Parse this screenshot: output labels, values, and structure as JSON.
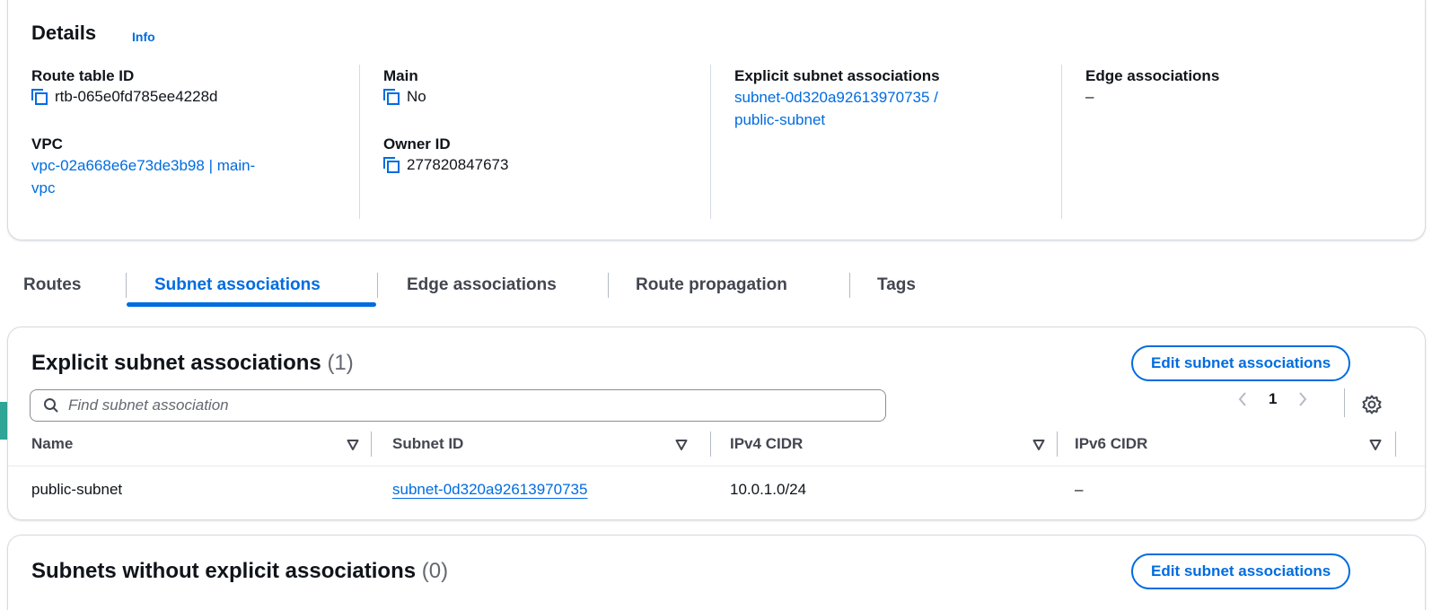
{
  "details": {
    "title": "Details",
    "info": "Info",
    "route_table_id_label": "Route table ID",
    "route_table_id": "rtb-065e0fd785ee4228d",
    "vpc_label": "VPC",
    "vpc_line1": "vpc-02a668e6e73de3b98 | main-",
    "vpc_line2": "vpc",
    "main_label": "Main",
    "main_value": "No",
    "owner_label": "Owner ID",
    "owner_value": "277820847673",
    "explicit_label": "Explicit subnet associations",
    "explicit_line1": "subnet-0d320a92613970735 /",
    "explicit_line2": "public-subnet",
    "edge_label": "Edge associations",
    "edge_value": "–"
  },
  "tabs": [
    {
      "label": "Routes",
      "active": false
    },
    {
      "label": "Subnet associations",
      "active": true
    },
    {
      "label": "Edge associations",
      "active": false
    },
    {
      "label": "Route propagation",
      "active": false
    },
    {
      "label": "Tags",
      "active": false
    }
  ],
  "explicit_panel": {
    "title": "Explicit subnet associations",
    "count": "(1)",
    "edit_button": "Edit subnet associations",
    "search_placeholder": "Find subnet association",
    "page_number": "1",
    "columns": [
      "Name",
      "Subnet ID",
      "IPv4 CIDR",
      "IPv6 CIDR"
    ],
    "rows": [
      {
        "name": "public-subnet",
        "subnet_id": "subnet-0d320a92613970735",
        "ipv4": "10.0.1.0/24",
        "ipv6": "–"
      }
    ]
  },
  "without_panel": {
    "title": "Subnets without explicit associations",
    "count": "(0)",
    "edit_button": "Edit subnet associations"
  },
  "icons": {
    "copy": "copy-icon",
    "search": "search-icon",
    "prev": "chevron-left-icon",
    "next": "chevron-right-icon",
    "settings": "gear-icon",
    "sort": "sort-down-icon"
  },
  "colors": {
    "link": "#006ce0",
    "text": "#0f141a",
    "border": "#d5dbe2"
  }
}
